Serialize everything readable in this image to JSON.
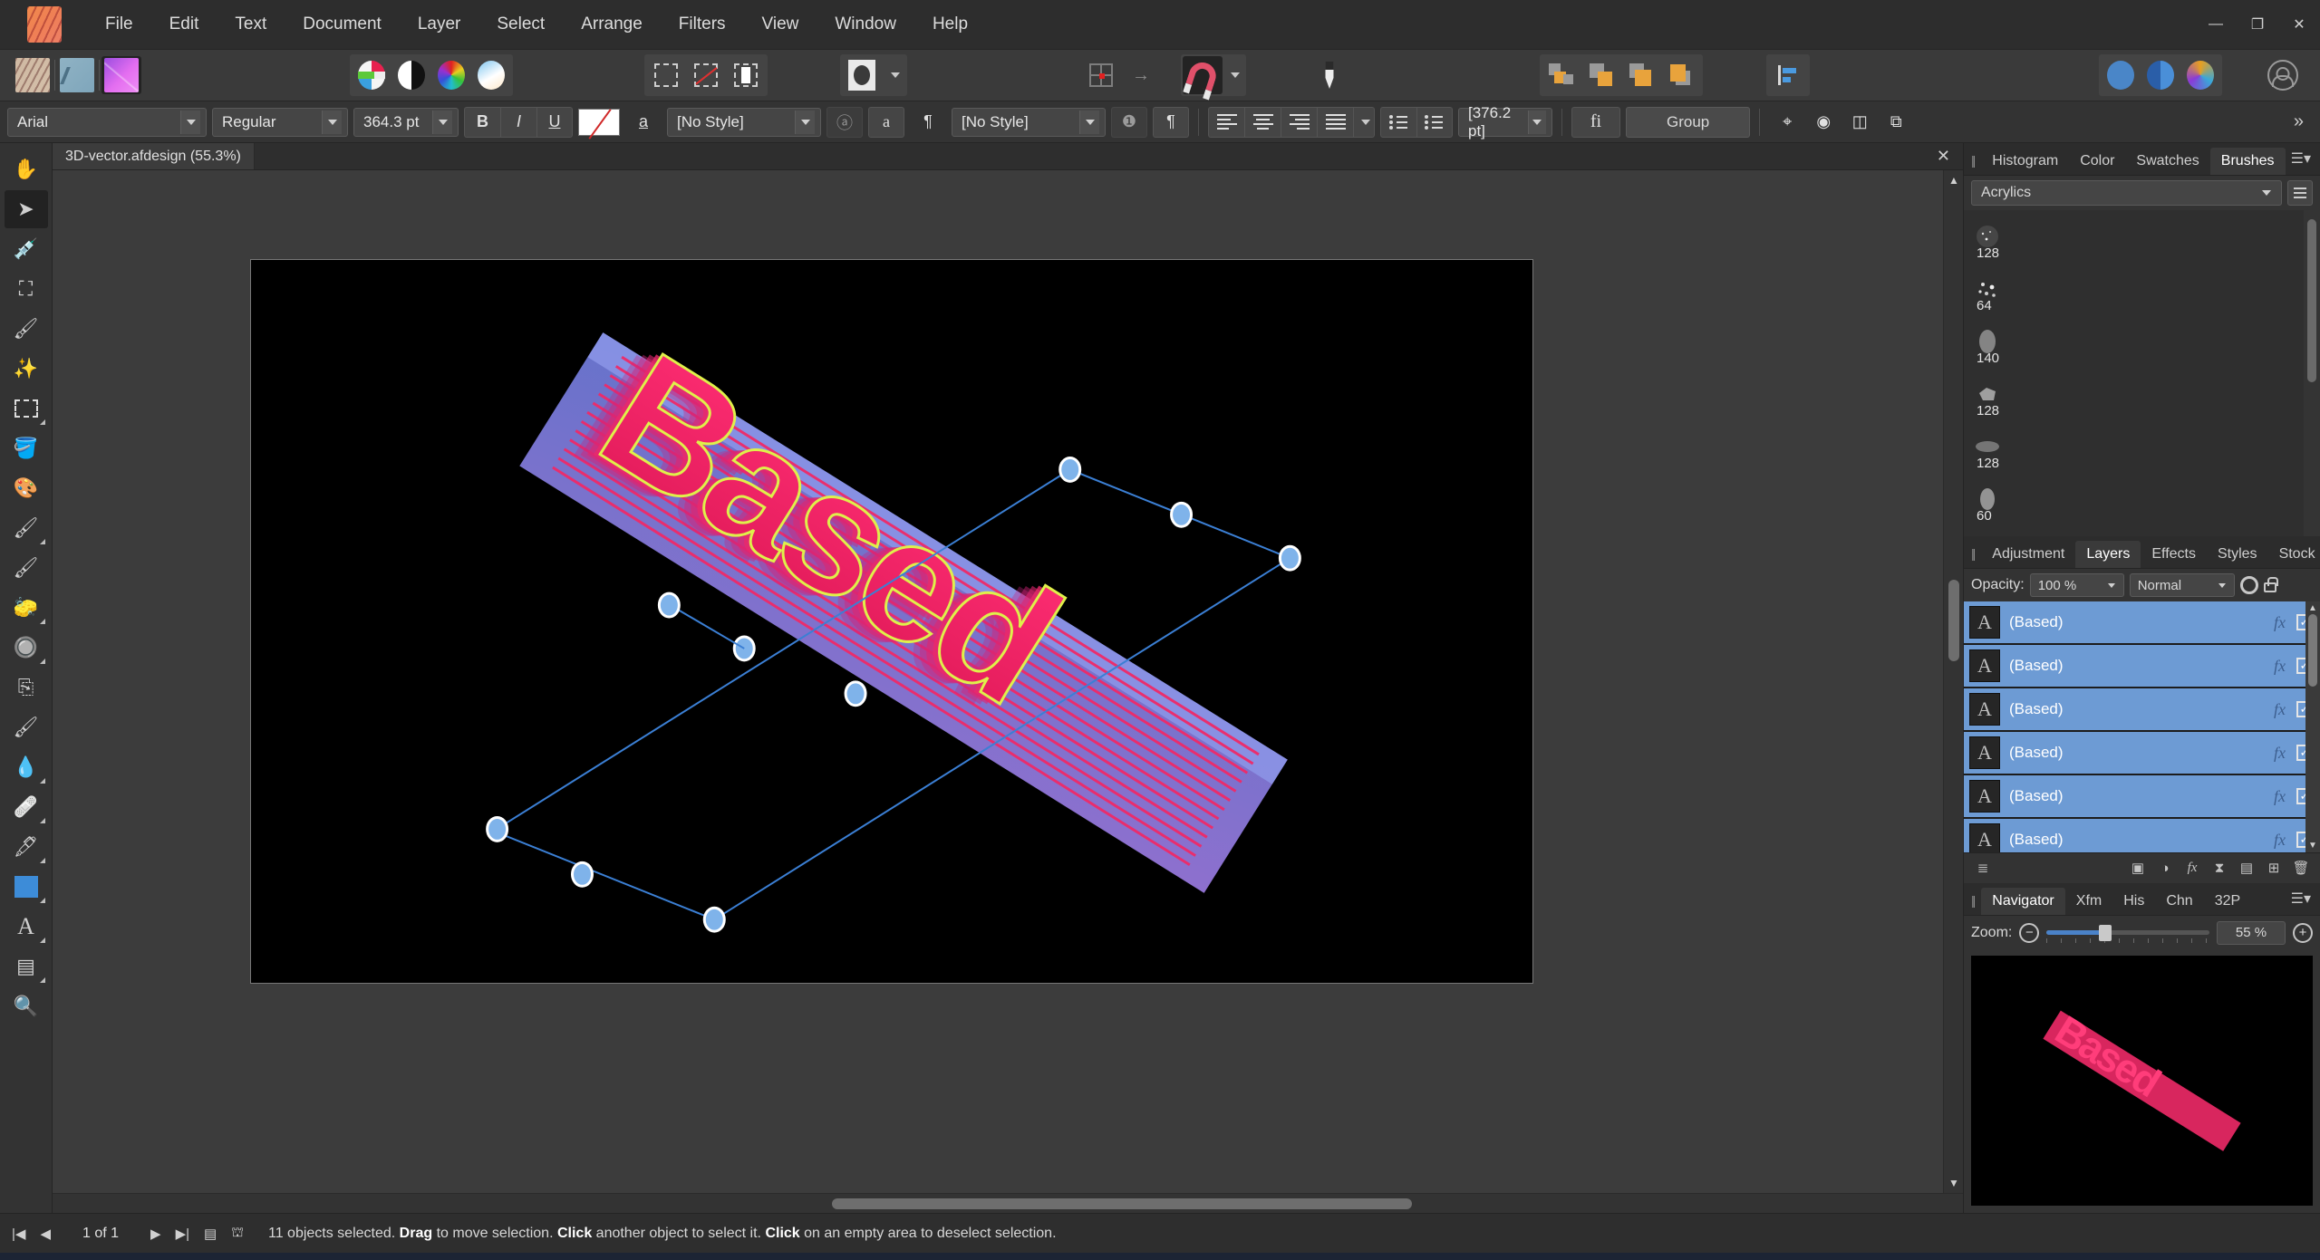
{
  "menu": {
    "logo_icon": "affinity-designer-logo",
    "items": [
      "File",
      "Edit",
      "Text",
      "Document",
      "Layer",
      "Select",
      "Arrange",
      "Filters",
      "View",
      "Window",
      "Help"
    ],
    "window_controls": [
      {
        "name": "minimize",
        "glyph": "—"
      },
      {
        "name": "restore",
        "glyph": "❐"
      },
      {
        "name": "close",
        "glyph": "✕"
      }
    ]
  },
  "toolbar": {
    "personas": [
      {
        "name": "pixel-persona",
        "label": "Pixel Persona"
      },
      {
        "name": "export-persona",
        "label": "Export Persona"
      },
      {
        "name": "designer-persona",
        "label": "Designer Persona"
      }
    ],
    "color_buttons": [
      {
        "name": "rgb-circle-icon"
      },
      {
        "name": "black-white-circle-icon"
      },
      {
        "name": "color-wheel-icon"
      },
      {
        "name": "gradient-circle-icon"
      }
    ],
    "selection_buttons": [
      {
        "name": "select-all-icon"
      },
      {
        "name": "deselect-icon"
      },
      {
        "name": "invert-selection-icon"
      }
    ],
    "shape_dropdown": {
      "name": "shape-style-dropdown"
    },
    "grid_button": {
      "name": "grid-icon"
    },
    "move_button": {
      "name": "move-arrow-icon"
    },
    "snapping_button": {
      "name": "magnet-icon"
    },
    "pin_button": {
      "name": "pin-icon"
    },
    "arrange_buttons": [
      {
        "name": "arrange-back-icon"
      },
      {
        "name": "arrange-backward-icon"
      },
      {
        "name": "arrange-forward-icon"
      },
      {
        "name": "arrange-front-icon"
      }
    ],
    "align_button": {
      "name": "align-icon"
    },
    "right_color_buttons": [
      {
        "name": "colour-picker-icon"
      },
      {
        "name": "swatch-circle-icon"
      },
      {
        "name": "gradient-tool-icon"
      }
    ],
    "account_button": {
      "name": "account-avatar-icon"
    }
  },
  "text_toolbar": {
    "font_family": "Arial",
    "font_style": "Regular",
    "font_size": "364.3 pt",
    "bold_label": "B",
    "italic_label": "I",
    "underline_label": "U",
    "no_fill_swatch": "no-fill",
    "text_decoration_label": "a",
    "character_style": "[No Style]",
    "paragraph_style": "[No Style]",
    "leading": "[376.2 pt]",
    "ligature_label": "fi",
    "group_label": "Group",
    "pilcrow": "¶",
    "align_icons": [
      "align-left-icon",
      "align-center-icon",
      "align-right-icon",
      "align-justify-icon"
    ],
    "list_icons": [
      "bulleted-list-icon",
      "numbered-list-icon"
    ],
    "transform_icons": [
      "rotation-center-icon",
      "target-icon",
      "flip-icon",
      "duplicate-icon"
    ],
    "overflow_chevron": "»"
  },
  "document": {
    "tab_label": "3D-vector.afdesign (55.3%)",
    "close_glyph": "✕"
  },
  "tools": [
    {
      "name": "view-tool",
      "icon": "hand-icon",
      "active": false,
      "sub": false
    },
    {
      "name": "move-tool",
      "icon": "arrow-cursor-icon",
      "active": true,
      "sub": false
    },
    {
      "name": "colour-picker-tool",
      "icon": "eyedropper-icon",
      "active": false,
      "sub": false
    },
    {
      "name": "crop-tool",
      "icon": "crop-icon",
      "active": false,
      "sub": false
    },
    {
      "name": "selection-brush-tool",
      "icon": "selection-brush-icon",
      "active": false,
      "sub": false
    },
    {
      "name": "flood-select-tool",
      "icon": "magic-wand-icon",
      "active": false,
      "sub": false
    },
    {
      "name": "marquee-tool",
      "icon": "marquee-icon",
      "active": false,
      "sub": true
    },
    {
      "name": "flood-fill-tool",
      "icon": "paint-bucket-icon",
      "active": false,
      "sub": false
    },
    {
      "name": "colour-replacement-tool",
      "icon": "colour-wheel-brush-icon",
      "active": false,
      "sub": false
    },
    {
      "name": "paint-brush-tool",
      "icon": "paintbrush-icon",
      "active": false,
      "sub": true
    },
    {
      "name": "pixel-tool",
      "icon": "colour-brush-icon",
      "active": false,
      "sub": false
    },
    {
      "name": "erase-brush-tool",
      "icon": "eraser-icon",
      "active": false,
      "sub": true
    },
    {
      "name": "dodge-brush-tool",
      "icon": "dodge-icon",
      "active": false,
      "sub": true
    },
    {
      "name": "clone-brush-tool",
      "icon": "clone-stamp-icon",
      "active": false,
      "sub": false
    },
    {
      "name": "smudge-brush-tool",
      "icon": "smudge-brush-icon",
      "active": false,
      "sub": false
    },
    {
      "name": "blur-brush-tool",
      "icon": "water-drop-icon",
      "active": false,
      "sub": true
    },
    {
      "name": "patch-tool",
      "icon": "bandage-icon",
      "active": false,
      "sub": true
    },
    {
      "name": "pen-tool",
      "icon": "fountain-pen-icon",
      "active": false,
      "sub": true
    },
    {
      "name": "rectangle-tool",
      "icon": "blue-square-icon",
      "active": false,
      "sub": true
    },
    {
      "name": "artistic-text-tool",
      "icon": "text-a-icon",
      "active": false,
      "sub": true
    },
    {
      "name": "mesh-warp-tool",
      "icon": "mesh-warp-icon",
      "active": false,
      "sub": true
    },
    {
      "name": "zoom-tool",
      "icon": "magnifier-icon",
      "active": false,
      "sub": false
    }
  ],
  "artwork": {
    "text": "Based",
    "description": "3D extruded vector text selected with bounding box",
    "fill_color": "#ef2a68",
    "extrude_color": "#7b86e0",
    "highlight_color": "#d9f03a",
    "background": "#000000",
    "selection_color": "#3b7fd4",
    "handle_fill": "#7fb3ea"
  },
  "panels": {
    "top": {
      "tabs": [
        "Histogram",
        "Color",
        "Swatches",
        "Brushes"
      ],
      "active_tab": "Brushes",
      "menu_icon": "panel-menu-icon",
      "brush_category": "Acrylics",
      "list_view_icon": "list-view-icon",
      "brushes": [
        {
          "size": "128"
        },
        {
          "size": "64"
        },
        {
          "size": "140"
        },
        {
          "size": "128"
        },
        {
          "size": "128"
        },
        {
          "size": "60"
        }
      ]
    },
    "layers": {
      "tabs": [
        "Adjustment",
        "Layers",
        "Effects",
        "Styles",
        "Stock"
      ],
      "active_tab": "Layers",
      "opacity_label": "Opacity:",
      "opacity_value": "100 %",
      "blend_mode": "Normal",
      "gear_icon": "gear-icon",
      "lock_icon": "lock-icon",
      "rows": [
        {
          "name": "(Based)",
          "thumb": "A",
          "fx": "fx",
          "checked": true
        },
        {
          "name": "(Based)",
          "thumb": "A",
          "fx": "fx",
          "checked": true
        },
        {
          "name": "(Based)",
          "thumb": "A",
          "fx": "fx",
          "checked": true
        },
        {
          "name": "(Based)",
          "thumb": "A",
          "fx": "fx",
          "checked": true
        },
        {
          "name": "(Based)",
          "thumb": "A",
          "fx": "fx",
          "checked": true
        },
        {
          "name": "(Based)",
          "thumb": "A",
          "fx": "fx",
          "checked": true
        }
      ],
      "footer_icons": [
        "layers-stack-icon",
        "mask-icon",
        "adjustment-icon",
        "effects-icon",
        "hourglass-icon",
        "new-group-icon",
        "new-layer-icon",
        "delete-layer-icon"
      ]
    },
    "navigator": {
      "tabs": [
        "Navigator",
        "Xfm",
        "His",
        "Chn",
        "32P"
      ],
      "active_tab": "Navigator",
      "menu_icon": "panel-menu-icon",
      "zoom_label": "Zoom:",
      "zoom_value": "55 %",
      "zoom_out_glyph": "−",
      "zoom_in_glyph": "+"
    }
  },
  "statusbar": {
    "first_page_icon": "first-page-icon",
    "prev_page_icon": "previous-page-icon",
    "page_indicator": "1 of 1",
    "next_page_icon": "next-page-icon",
    "last_page_icon": "last-page-icon",
    "pages_icon": "pages-icon",
    "lighthouse_icon": "assistant-icon",
    "message_parts": [
      {
        "text": "11 objects selected. ",
        "bold": false
      },
      {
        "text": "Drag",
        "bold": true
      },
      {
        "text": " to move selection. ",
        "bold": false
      },
      {
        "text": "Click",
        "bold": true
      },
      {
        "text": " another object to select it. ",
        "bold": false
      },
      {
        "text": "Click",
        "bold": true
      },
      {
        "text": " on an empty area to deselect selection.",
        "bold": false
      }
    ]
  }
}
